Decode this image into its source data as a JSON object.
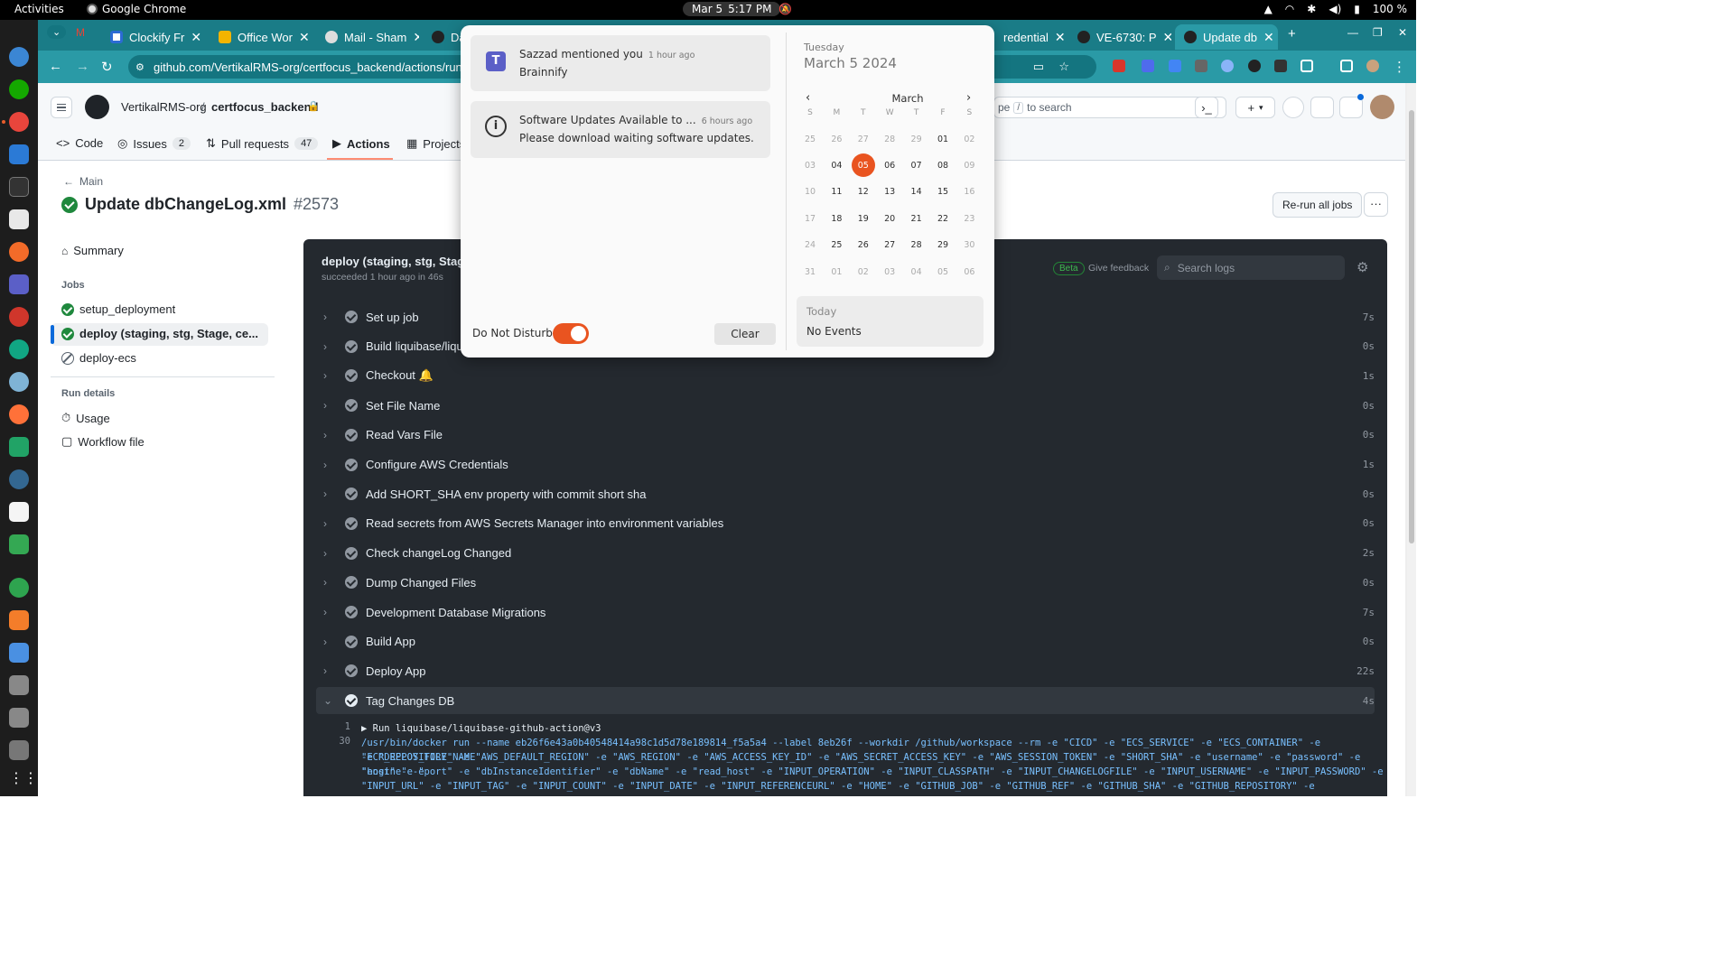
{
  "topbar": {
    "activities": "Activities",
    "app_name": "Google Chrome",
    "date": "Mar 5",
    "time": "5:17 PM",
    "battery": "100 %"
  },
  "chrome": {
    "tabs": [
      {
        "label": "Clockify Fr",
        "icon": "clockify-icon",
        "color": "#2c6bd4"
      },
      {
        "label": "Office Wor",
        "icon": "google-drive-icon",
        "color": "#f4b400"
      },
      {
        "label": "Mail - Sham",
        "icon": "mail-icon",
        "color": "#dddddd"
      },
      {
        "label": "Da",
        "icon": "github-icon",
        "color": "#222222"
      },
      {
        "label": "redential",
        "icon": "github-icon",
        "color": "#222222"
      },
      {
        "label": "VE-6730: P",
        "icon": "github-icon",
        "color": "#222222"
      },
      {
        "label": "Update db",
        "icon": "github-icon",
        "color": "#222222"
      }
    ],
    "url": "github.com/VertikalRMS-org/certfocus_backend/actions/runs/815"
  },
  "github": {
    "org": "VertikalRMS-org",
    "separator": "/",
    "repo": "certfocus_backend",
    "search_placeholder_a": "pe",
    "search_key": "/",
    "search_placeholder_b": "to search",
    "nav": [
      {
        "label": "Code",
        "icon": "code-icon"
      },
      {
        "label": "Issues",
        "icon": "issue-icon",
        "count": "2"
      },
      {
        "label": "Pull requests",
        "icon": "pull-request-icon",
        "count": "47"
      },
      {
        "label": "Actions",
        "icon": "play-icon"
      },
      {
        "label": "Projects",
        "icon": "table-icon"
      }
    ],
    "back_label": "Main",
    "run_title": "Update dbChangeLog.xml",
    "run_number": "#2573",
    "rerun_label": "Re-run all jobs",
    "sidebar": {
      "summary": "Summary",
      "jobs_heading": "Jobs",
      "jobs": [
        {
          "label": "setup_deployment",
          "status": "success"
        },
        {
          "label": "deploy (staging, stg, Stage, ce...",
          "status": "success"
        },
        {
          "label": "deploy-ecs",
          "status": "skipped"
        }
      ],
      "run_details_heading": "Run details",
      "usage": "Usage",
      "workflow_file": "Workflow file"
    },
    "job": {
      "title": "deploy (staging, stg, Stag",
      "subtitle": "succeeded 1 hour ago in 46s",
      "beta": "Beta",
      "feedback": "Give feedback",
      "search_placeholder": "Search logs",
      "steps": [
        {
          "label": "Set up job",
          "duration": "7s"
        },
        {
          "label": "Build liquibase/liquiba",
          "duration": "0s"
        },
        {
          "label": "Checkout 🔔",
          "duration": "1s"
        },
        {
          "label": "Set File Name",
          "duration": "0s"
        },
        {
          "label": "Read Vars File",
          "duration": "0s"
        },
        {
          "label": "Configure AWS Credentials",
          "duration": "1s"
        },
        {
          "label": "Add SHORT_SHA env property with commit short sha",
          "duration": "0s"
        },
        {
          "label": "Read secrets from AWS Secrets Manager into environment variables",
          "duration": "0s"
        },
        {
          "label": "Check changeLog Changed",
          "duration": "2s"
        },
        {
          "label": "Dump Changed Files",
          "duration": "0s"
        },
        {
          "label": "Development Database Migrations",
          "duration": "7s"
        },
        {
          "label": "Build App",
          "duration": "0s"
        },
        {
          "label": "Deploy App",
          "duration": "22s"
        },
        {
          "label": "Tag Changes DB",
          "duration": "4s"
        }
      ],
      "log": {
        "line1_num": "1",
        "line1": "▶ Run liquibase/liquibase-github-action@v3",
        "line30_num": "30",
        "line30": [
          "/usr/bin/docker run --name eb26f6e43a0b40548414a98c1d5d78e189814_f5a5a4 --label 8eb26f --workdir /github/workspace --rm -e \"CICD\" -e \"ECS_SERVICE\" -e \"ECS_CONTAINER\" -e \"ECR_REPOSITORY_NAME\"",
          "-e \"DEPLOY_FILE\" -e \"AWS_DEFAULT_REGION\" -e \"AWS_REGION\" -e \"AWS_ACCESS_KEY_ID\" -e \"AWS_SECRET_ACCESS_KEY\" -e \"AWS_SESSION_TOKEN\" -e \"SHORT_SHA\" -e \"username\" -e \"password\" -e \"engine\" -e",
          "\"host\" -e \"port\" -e \"dbInstanceIdentifier\" -e \"dbName\" -e \"read_host\" -e \"INPUT_OPERATION\" -e \"INPUT_CLASSPATH\" -e \"INPUT_CHANGELOGFILE\" -e \"INPUT_USERNAME\" -e \"INPUT_PASSWORD\" -e",
          "\"INPUT_URL\" -e \"INPUT_TAG\" -e \"INPUT_COUNT\" -e \"INPUT_DATE\" -e \"INPUT_REFERENCEURL\" -e \"HOME\" -e \"GITHUB_JOB\" -e \"GITHUB_REF\" -e \"GITHUB_SHA\" -e \"GITHUB_REPOSITORY\" -e"
        ]
      }
    }
  },
  "notifications": {
    "items": [
      {
        "title": "Sazzad mentioned you",
        "time": "1 hour ago",
        "body": "Brainnify",
        "icon": "teams-icon"
      },
      {
        "title": "Software Updates Available to ...",
        "time": "6 hours ago",
        "body": "Please download waiting software updates.",
        "icon": "info-icon"
      }
    ],
    "dnd_label": "Do Not Disturb",
    "dnd_on": true,
    "clear_label": "Clear"
  },
  "calendar": {
    "weekday": "Tuesday",
    "date": "March 5 2024",
    "month": "March",
    "day_headers": [
      "S",
      "M",
      "T",
      "W",
      "T",
      "F",
      "S"
    ],
    "weeks": [
      [
        "25",
        "26",
        "27",
        "28",
        "29",
        "01",
        "02"
      ],
      [
        "03",
        "04",
        "05",
        "06",
        "07",
        "08",
        "09"
      ],
      [
        "10",
        "11",
        "12",
        "13",
        "14",
        "15",
        "16"
      ],
      [
        "17",
        "18",
        "19",
        "20",
        "21",
        "22",
        "23"
      ],
      [
        "24",
        "25",
        "26",
        "27",
        "28",
        "29",
        "30"
      ],
      [
        "31",
        "01",
        "02",
        "03",
        "04",
        "05",
        "06"
      ]
    ],
    "selected": "05",
    "events_heading": "Today",
    "events_body": "No Events"
  },
  "colors": {
    "accent": "#e95420",
    "success": "#1f883d",
    "chrome_teal": "#2a9aa6"
  }
}
